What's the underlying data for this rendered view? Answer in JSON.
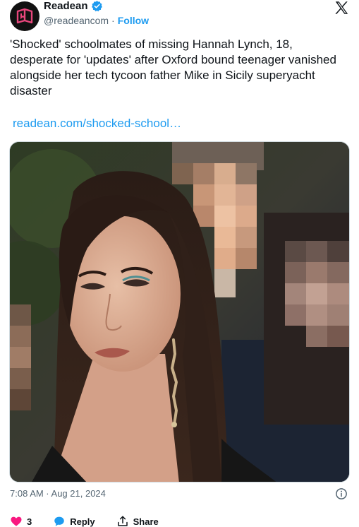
{
  "account": {
    "name": "Readean",
    "handle": "@readeancom",
    "separator": "·",
    "follow_label": "Follow"
  },
  "tweet": {
    "text": "'Shocked' schoolmates of missing Hannah Lynch, 18, desperate for 'updates' after Oxford bound teenager vanished alongside her tech tycoon father Mike in Sicily superyacht disaster",
    "link": "readean.com/shocked-school…",
    "timestamp": "7:08 AM · Aug 21, 2024"
  },
  "actions": {
    "like_count": "3",
    "reply_label": "Reply",
    "share_label": "Share"
  },
  "colors": {
    "accent": "#1d9bf0",
    "like": "#f91880",
    "avatar_logo": "#e8467c"
  },
  "icons": [
    "readean-logo-icon",
    "verified-badge-icon",
    "x-logo-icon",
    "info-icon",
    "heart-icon",
    "reply-bubble-icon",
    "share-icon"
  ]
}
